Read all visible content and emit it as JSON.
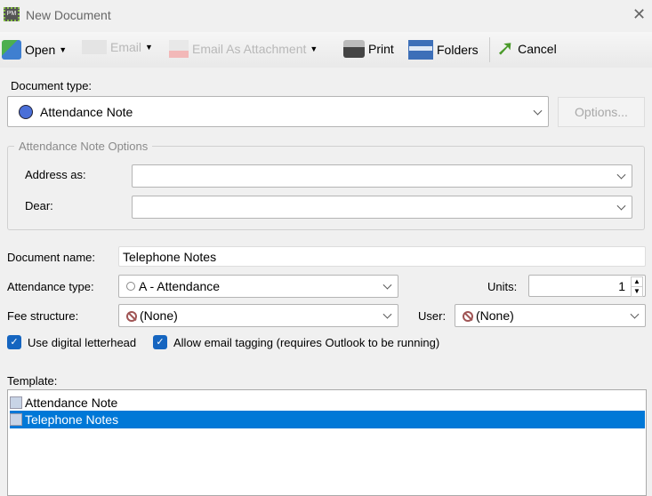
{
  "window": {
    "title": "New Document",
    "app_icon_text": "PM"
  },
  "toolbar": {
    "open": "Open",
    "email": "Email",
    "email_attachment": "Email As Attachment",
    "print": "Print",
    "folders": "Folders",
    "cancel": "Cancel"
  },
  "document_type": {
    "label": "Document type:",
    "value": "Attendance Note",
    "options_button": "Options..."
  },
  "options_group": {
    "title": "Attendance Note Options",
    "address_as_label": "Address as:",
    "address_as_value": "",
    "dear_label": "Dear:",
    "dear_value": ""
  },
  "form": {
    "document_name_label": "Document name:",
    "document_name_value": "Telephone Notes",
    "attendance_type_label": "Attendance type:",
    "attendance_type_value": "A - Attendance",
    "units_label": "Units:",
    "units_value": "1",
    "fee_structure_label": "Fee structure:",
    "fee_structure_value": "(None)",
    "user_label": "User:",
    "user_value": "(None)"
  },
  "checkboxes": {
    "letterhead": "Use digital letterhead",
    "email_tagging": "Allow email tagging (requires Outlook to be running)"
  },
  "template": {
    "label": "Template:",
    "items": [
      "Attendance Note",
      "Telephone Notes"
    ],
    "selected": 1
  },
  "colors": {
    "selection": "#0078d7",
    "checkbox": "#1565c0"
  }
}
